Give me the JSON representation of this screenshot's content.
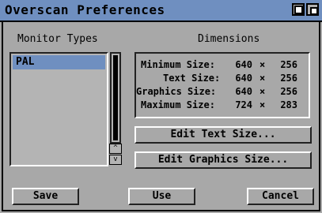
{
  "window": {
    "title": "Overscan Preferences"
  },
  "monitor_types": {
    "heading": "Monitor Types",
    "items": [
      "PAL"
    ],
    "scroll_up": "^",
    "scroll_down": "v"
  },
  "dimensions": {
    "heading": "Dimensions",
    "rows": [
      {
        "label": "Minimum Size:",
        "width": "640",
        "sep": "×",
        "height": "256"
      },
      {
        "label": "Text Size:",
        "width": "640",
        "sep": "×",
        "height": "256"
      },
      {
        "label": "Graphics Size:",
        "width": "640",
        "sep": "×",
        "height": "256"
      },
      {
        "label": "Maximum Size:",
        "width": "724",
        "sep": "×",
        "height": "283"
      }
    ]
  },
  "buttons": {
    "edit_text": "Edit Text Size...",
    "edit_graphics": "Edit Graphics Size...",
    "save": "Save",
    "use": "Use",
    "cancel": "Cancel"
  },
  "colors": {
    "accent": "#6f8fc0",
    "background": "#a8a8a8"
  },
  "icons": {
    "depth_gadget": "depth-gadget-icon",
    "zoom_gadget": "zoom-gadget-icon"
  }
}
